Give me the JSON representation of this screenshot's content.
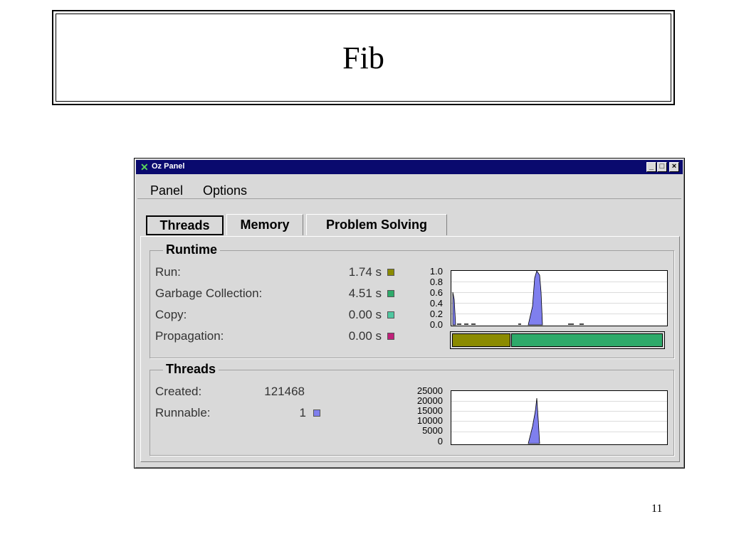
{
  "slide": {
    "title": "Fib",
    "page_number": "11"
  },
  "window": {
    "title": "Oz Panel",
    "controls": {
      "minimize": "_",
      "maximize": "□",
      "close": "×"
    }
  },
  "menu": {
    "items": [
      "Panel",
      "Options"
    ]
  },
  "tabs": [
    {
      "label": "Threads",
      "selected": true
    },
    {
      "label": "Memory",
      "selected": false
    },
    {
      "label": "Problem Solving",
      "selected": false
    }
  ],
  "runtime": {
    "label": "Runtime",
    "rows": [
      {
        "label": "Run:",
        "value": "1.74 s",
        "color": "#8b8b00"
      },
      {
        "label": "Garbage Collection:",
        "value": "4.51 s",
        "color": "#2eaa6a"
      },
      {
        "label": "Copy:",
        "value": "0.00 s",
        "color": "#4fc7a0"
      },
      {
        "label": "Propagation:",
        "value": "0.00 s",
        "color": "#c0207a"
      }
    ],
    "chart": {
      "yticks": [
        "1.0",
        "0.8",
        "0.6",
        "0.4",
        "0.2",
        "0.0"
      ],
      "fill": "#7f7fee"
    },
    "ratio": {
      "run_fraction": 0.28,
      "gc_fraction": 0.72,
      "run_color": "#8b8b00",
      "gc_color": "#2eaa6a"
    }
  },
  "threads": {
    "label": "Threads",
    "created_label": "Created:",
    "created_value": "121468",
    "runnable_label": "Runnable:",
    "runnable_value": "1",
    "runnable_color": "#7f7fee",
    "chart": {
      "yticks": [
        "25000",
        "20000",
        "15000",
        "10000",
        "5000",
        "0"
      ],
      "fill": "#7f7fee"
    }
  }
}
